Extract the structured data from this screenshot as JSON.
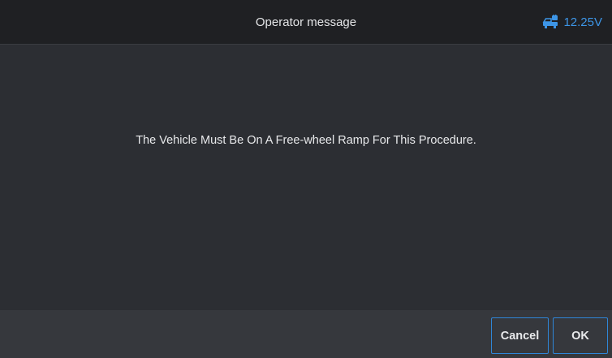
{
  "header": {
    "title": "Operator message",
    "voltage": "12.25V",
    "voltage_icon": "car-battery-icon",
    "accent_color": "#3d95e6"
  },
  "main": {
    "message": "The Vehicle Must Be On A Free-wheel Ramp For This Procedure."
  },
  "footer": {
    "cancel_label": "Cancel",
    "ok_label": "OK",
    "button_border_color": "#2f86d8"
  }
}
